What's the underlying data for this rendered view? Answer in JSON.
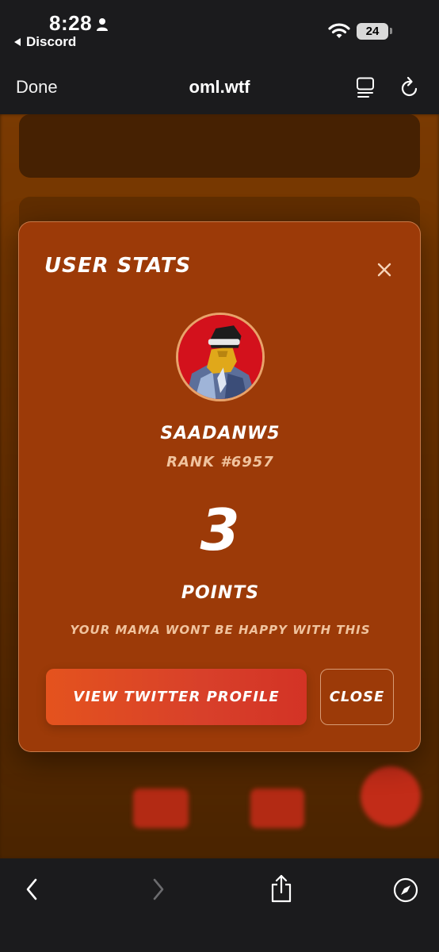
{
  "status_bar": {
    "time": "8:28",
    "back_app": "Discord",
    "battery": "24"
  },
  "browser": {
    "done_label": "Done",
    "url": "oml.wtf"
  },
  "modal": {
    "title": "User Stats",
    "username": "SAADANW5",
    "rank": "Rank #6957",
    "points_value": "3",
    "points_label": "Points",
    "message": "Your mama wont be happy with this",
    "twitter_button_label": "View Twitter Profile",
    "close_button_label": "Close"
  },
  "colors": {
    "modal_bg": "#9c3a08",
    "button_gradient_start": "#e4531e",
    "button_gradient_end": "#d33325",
    "chrome_bg": "#1b1b1d"
  },
  "icons": {
    "status": [
      "person-icon",
      "wifi-icon"
    ],
    "header": [
      "reader-icon",
      "reload-icon"
    ],
    "toolbar": [
      "back-arrow-icon",
      "forward-arrow-icon",
      "share-icon",
      "compass-icon"
    ]
  }
}
